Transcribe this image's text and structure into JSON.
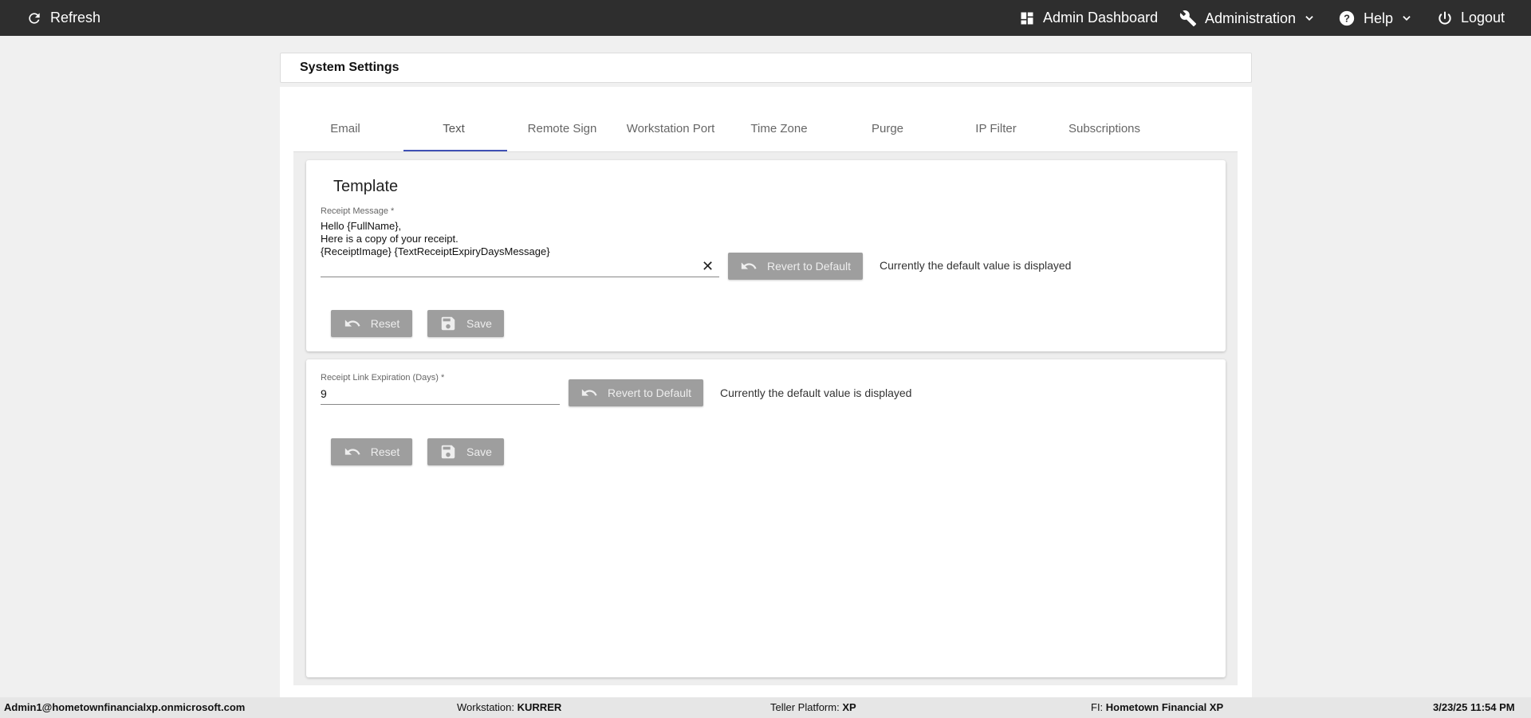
{
  "topbar": {
    "refresh_label": "Refresh",
    "admin_dashboard_label": "Admin Dashboard",
    "administration_label": "Administration",
    "help_label": "Help",
    "logout_label": "Logout",
    "icons": [
      "refresh-icon",
      "dashboard-icon",
      "wrench-icon",
      "chevron-down-icon",
      "help-circle-icon",
      "power-icon"
    ]
  },
  "header": {
    "title": "System Settings"
  },
  "tabs": [
    {
      "label": "Email"
    },
    {
      "label": "Text",
      "active": true
    },
    {
      "label": "Remote Sign"
    },
    {
      "label": "Workstation Port"
    },
    {
      "label": "Time Zone"
    },
    {
      "label": "Purge"
    },
    {
      "label": "IP Filter"
    },
    {
      "label": "Subscriptions"
    }
  ],
  "template_panel": {
    "title": "Template",
    "receipt_message": {
      "label": "Receipt Message *",
      "value": "Hello {FullName},\nHere is a copy of your receipt.\n{ReceiptImage} {TextReceiptExpiryDaysMessage}"
    },
    "revert_label": "Revert to Default",
    "default_note": "Currently the default value is displayed",
    "reset_label": "Reset",
    "save_label": "Save"
  },
  "expiration_panel": {
    "receipt_link_expiration": {
      "label": "Receipt Link Expiration (Days) *",
      "value": "9"
    },
    "revert_label": "Revert to Default",
    "default_note": "Currently the default value is displayed",
    "reset_label": "Reset",
    "save_label": "Save"
  },
  "statusbar": {
    "user": "Admin1@hometownfinancialxp.onmicrosoft.com",
    "workstation_label": "Workstation:",
    "workstation_value": "KURRER",
    "platform_label": "Teller Platform:",
    "platform_value": "XP",
    "fi_label": "FI:",
    "fi_value": "Hometown Financial XP",
    "datetime": "3/23/25 11:54 PM"
  },
  "colors": {
    "topbar_bg": "#2e2e2e",
    "tab_indicator": "#3f51b5",
    "disabled_button": "#9e9e9e"
  }
}
